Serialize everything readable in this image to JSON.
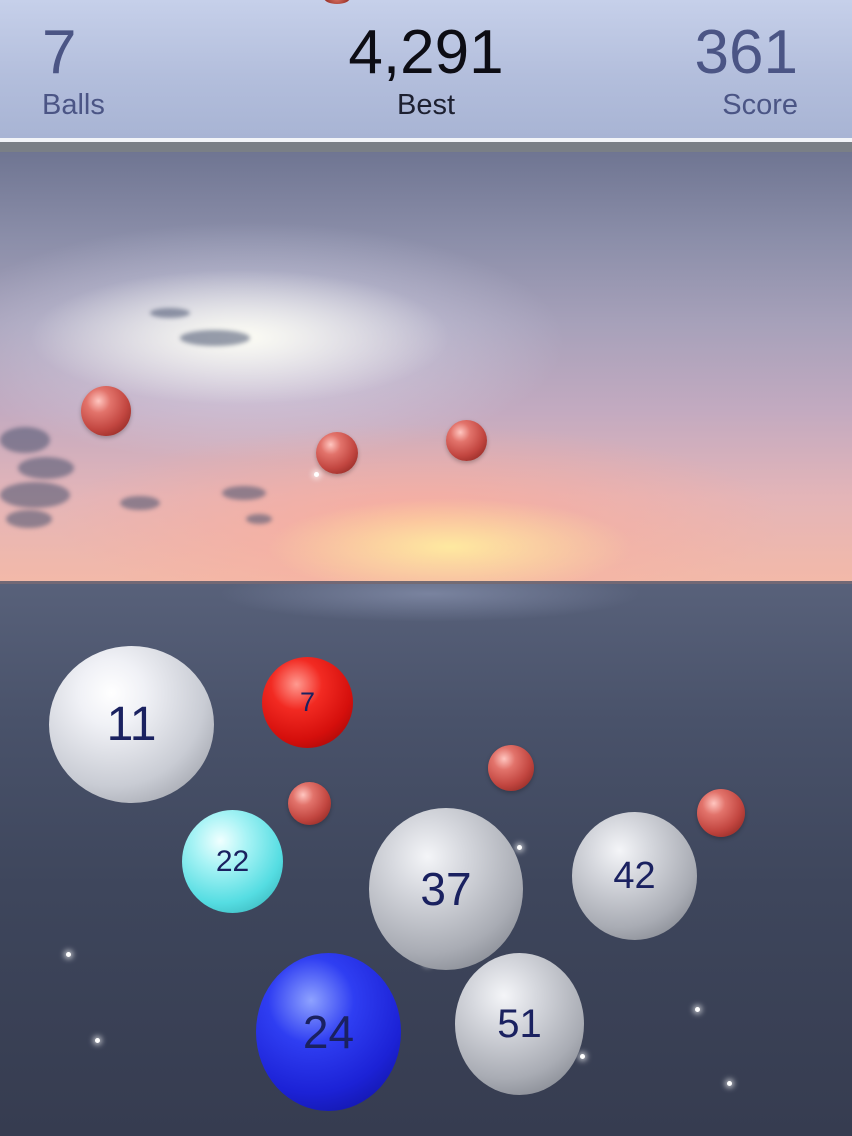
{
  "hud": {
    "balls": {
      "value": "7",
      "label": "Balls"
    },
    "best": {
      "value": "4,291",
      "label": "Best"
    },
    "score": {
      "value": "361",
      "label": "Score"
    }
  },
  "balls": [
    {
      "id": "11",
      "label": "11",
      "color": "white"
    },
    {
      "id": "7",
      "label": "7",
      "color": "red"
    },
    {
      "id": "22",
      "label": "22",
      "color": "cyan"
    },
    {
      "id": "37",
      "label": "37",
      "color": "silver"
    },
    {
      "id": "42",
      "label": "42",
      "color": "silver"
    },
    {
      "id": "24",
      "label": "24",
      "color": "blue"
    },
    {
      "id": "51",
      "label": "51",
      "color": "silver"
    }
  ],
  "colors": {
    "hud_text": "#4b5585",
    "best_text": "#0d0d14",
    "ball_number": "#1a2160"
  }
}
